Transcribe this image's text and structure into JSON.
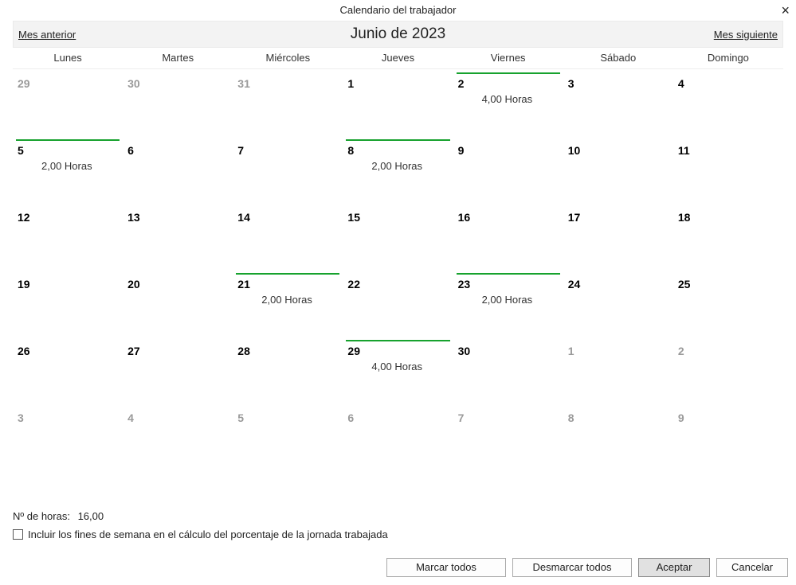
{
  "window": {
    "title": "Calendario del trabajador"
  },
  "nav": {
    "prev": "Mes anterior",
    "title": "Junio de 2023",
    "next": "Mes siguiente"
  },
  "dow": [
    "Lunes",
    "Martes",
    "Miércoles",
    "Jueves",
    "Viernes",
    "Sábado",
    "Domingo"
  ],
  "weeks": [
    [
      {
        "n": "29",
        "out": true
      },
      {
        "n": "30",
        "out": true
      },
      {
        "n": "31",
        "out": true
      },
      {
        "n": "1"
      },
      {
        "n": "2",
        "bar": true,
        "hours": "4,00 Horas"
      },
      {
        "n": "3"
      },
      {
        "n": "4"
      }
    ],
    [
      {
        "n": "5",
        "bar": true,
        "hours": "2,00 Horas"
      },
      {
        "n": "6"
      },
      {
        "n": "7"
      },
      {
        "n": "8",
        "bar": true,
        "hours": "2,00 Horas"
      },
      {
        "n": "9"
      },
      {
        "n": "10"
      },
      {
        "n": "11"
      }
    ],
    [
      {
        "n": "12"
      },
      {
        "n": "13"
      },
      {
        "n": "14"
      },
      {
        "n": "15"
      },
      {
        "n": "16"
      },
      {
        "n": "17"
      },
      {
        "n": "18"
      }
    ],
    [
      {
        "n": "19"
      },
      {
        "n": "20"
      },
      {
        "n": "21",
        "bar": true,
        "hours": "2,00 Horas"
      },
      {
        "n": "22"
      },
      {
        "n": "23",
        "bar": true,
        "hours": "2,00 Horas"
      },
      {
        "n": "24"
      },
      {
        "n": "25"
      }
    ],
    [
      {
        "n": "26"
      },
      {
        "n": "27"
      },
      {
        "n": "28"
      },
      {
        "n": "29",
        "bar": true,
        "hours": "4,00 Horas"
      },
      {
        "n": "30"
      },
      {
        "n": "1",
        "out": true
      },
      {
        "n": "2",
        "out": true
      }
    ],
    [
      {
        "n": "3",
        "out": true
      },
      {
        "n": "4",
        "out": true
      },
      {
        "n": "5",
        "out": true
      },
      {
        "n": "6",
        "out": true
      },
      {
        "n": "7",
        "out": true
      },
      {
        "n": "8",
        "out": true
      },
      {
        "n": "9",
        "out": true
      }
    ]
  ],
  "totals": {
    "label": "Nº de horas:",
    "value": "16,00"
  },
  "options": {
    "include_weekends": "Incluir los fines de semana en el cálculo del porcentaje de la jornada trabajada"
  },
  "buttons": {
    "select_all": "Marcar todos",
    "deselect_all": "Desmarcar todos",
    "accept": "Aceptar",
    "cancel": "Cancelar"
  },
  "colors": {
    "marker": "#17a22e"
  }
}
